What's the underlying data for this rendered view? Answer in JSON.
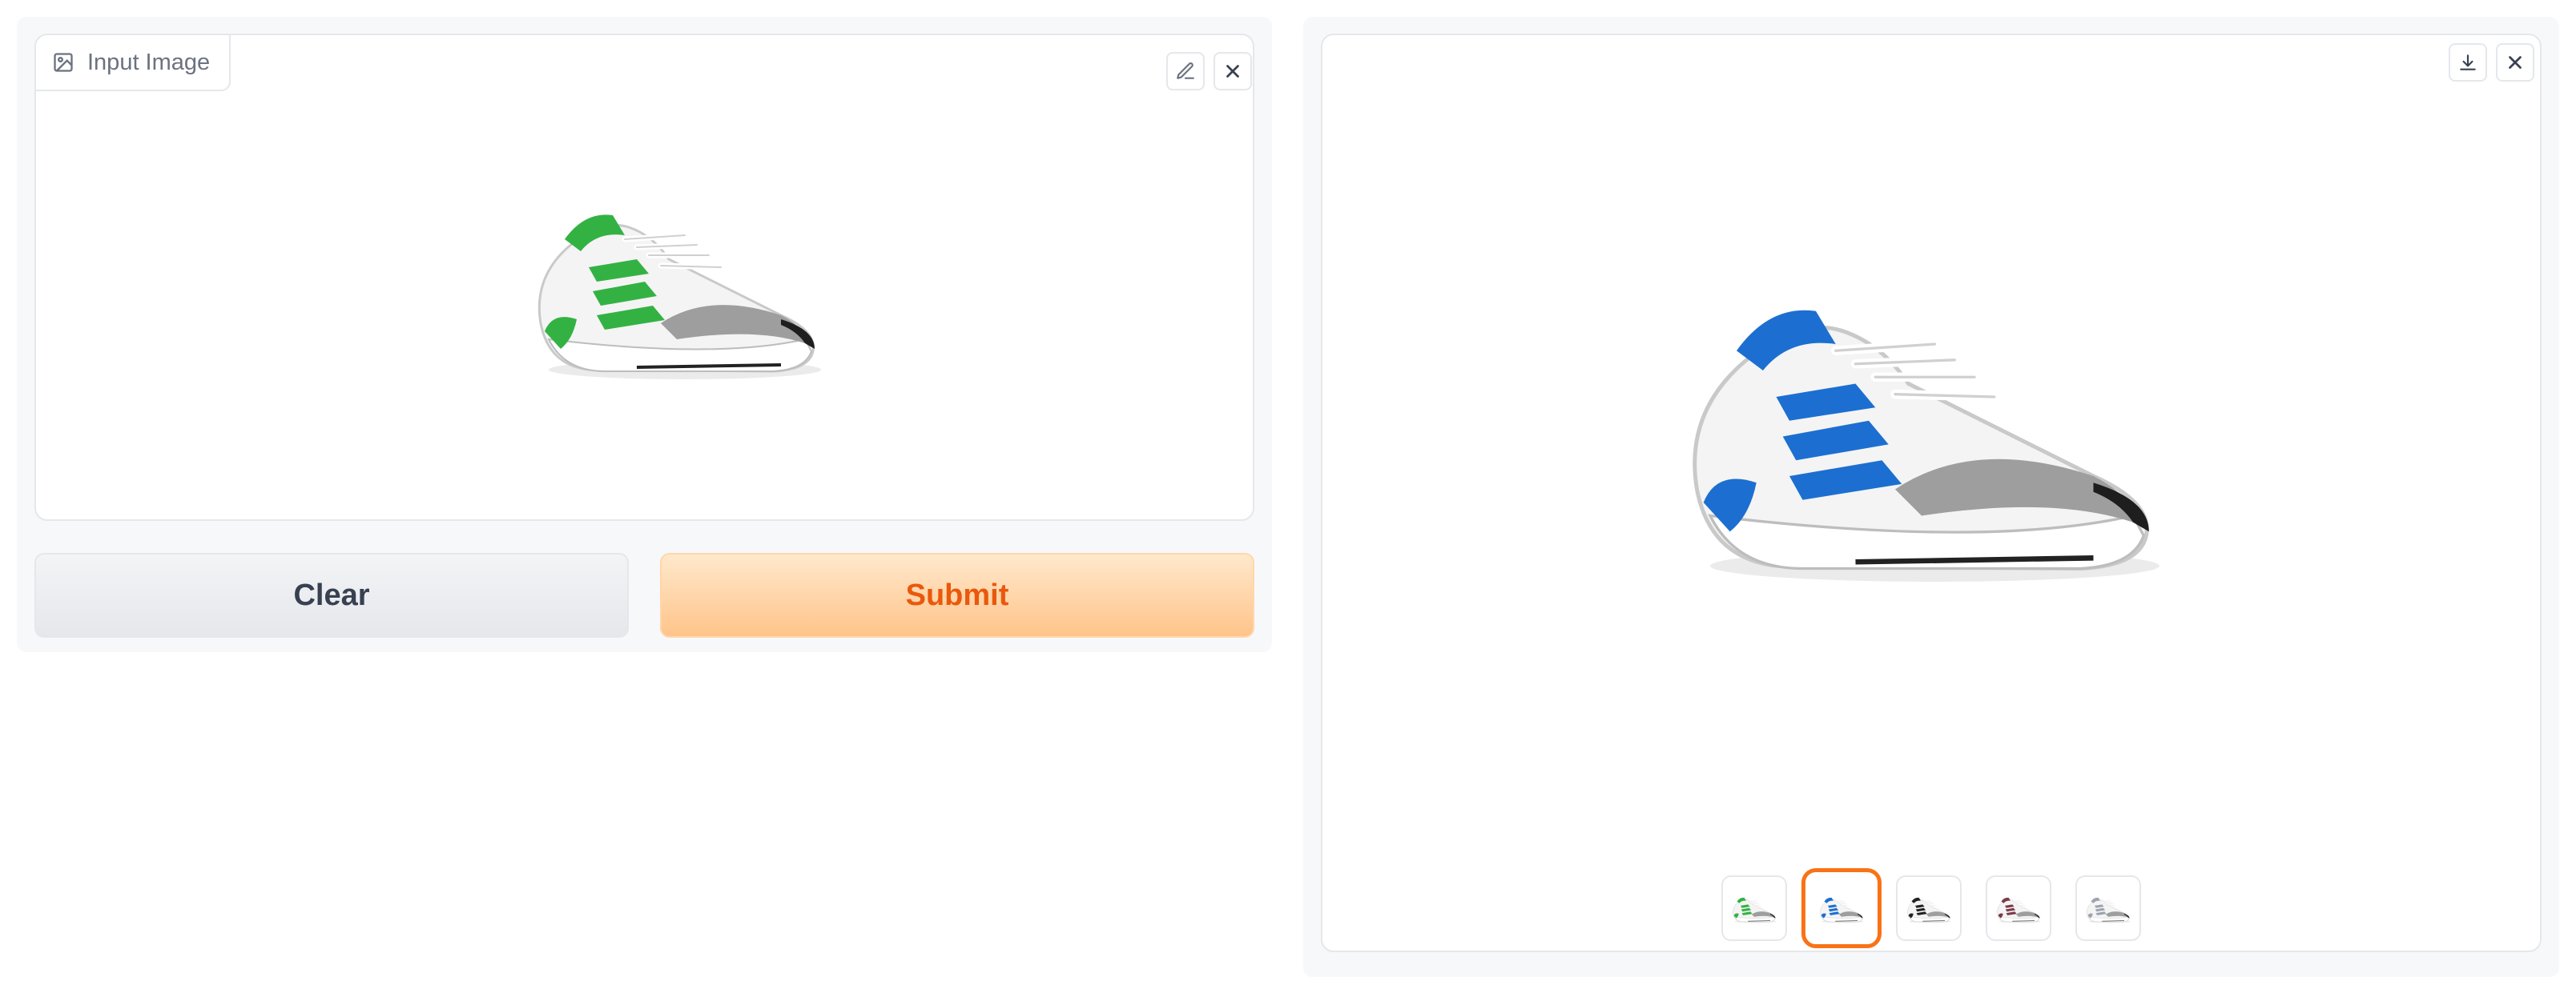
{
  "input": {
    "label": "Input Image",
    "shoe_accent": "#33b243"
  },
  "buttons": {
    "clear_label": "Clear",
    "submit_label": "Submit"
  },
  "gallery": {
    "main_accent": "#1c6fd1",
    "selected_index": 1,
    "thumbnails": [
      {
        "accent": "#33b243"
      },
      {
        "accent": "#1c6fd1"
      },
      {
        "accent": "#222222"
      },
      {
        "accent": "#7a3b4a"
      },
      {
        "accent": "#9ca3af"
      }
    ]
  },
  "colors": {
    "accent": "#f97316",
    "submit_text": "#ea580c",
    "border": "#e5e7eb"
  }
}
